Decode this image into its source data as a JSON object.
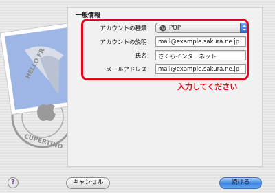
{
  "section_title": "一般情報",
  "fields": [
    {
      "label": "アカウントの種類：",
      "value": "POP",
      "type": "select",
      "icon": "globe-icon"
    },
    {
      "label": "アカウントの説明：",
      "value": "mail@example.sakura.ne.jp",
      "type": "text"
    },
    {
      "label": "氏名：",
      "value": "さくらインターネット",
      "type": "text"
    },
    {
      "label": "メールアドレス：",
      "value": "mail@example.sakura.ne.jp",
      "type": "text"
    }
  ],
  "annotation": "入力してください",
  "buttons": {
    "help": "?",
    "cancel": "キャンセル",
    "continue": "続ける"
  },
  "stamp_text": {
    "top": "HELLO FR",
    "bottom": "CUPERTINO"
  },
  "colors": {
    "annotation_red": "#e3061a",
    "primary_blue": "#3d86e2"
  }
}
